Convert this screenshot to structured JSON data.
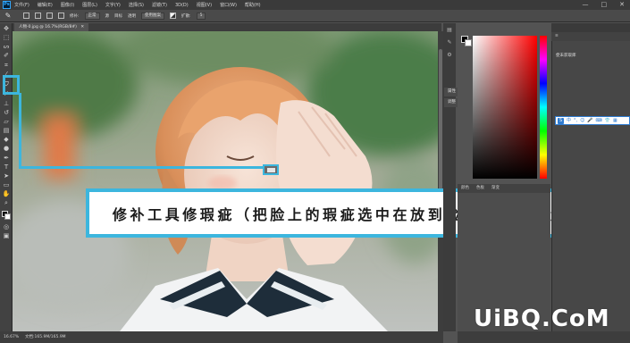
{
  "app": {
    "logo": "Ps",
    "window_controls": [
      "—",
      "□",
      "✕"
    ]
  },
  "menu": [
    "文件(F)",
    "编辑(E)",
    "图像(I)",
    "图层(L)",
    "文字(Y)",
    "选择(S)",
    "滤镜(T)",
    "3D(D)",
    "视图(V)",
    "窗口(W)",
    "帮助(H)"
  ],
  "options": {
    "patch_label": "修补:",
    "patch_mode": "正常",
    "source": "源",
    "target": "目标",
    "transparent": "透明",
    "use_pattern": "使用图案",
    "diffusion_label": "扩散:",
    "diffusion_value": "5"
  },
  "document": {
    "tab_title": "人物-0.jpg @ 16.7%(RGB/8#)",
    "close": "✕"
  },
  "status": {
    "zoom": "16.67%",
    "doc_size": "文档:165.9M/165.9M"
  },
  "right_mini_panels": {
    "properties": "属性",
    "adjustments": "调整"
  },
  "color_tabs": [
    "颜色",
    "色板",
    "渐变"
  ],
  "far_dock": {
    "libraries": "使未获取库",
    "ime_logo": "S"
  },
  "caption": "修补工具修瑕疵（把脸上的瑕疵选中在放到脸上干净的位置）",
  "watermark": "UiBQ.CoM",
  "icons": {
    "tools": [
      "move-icon",
      "marquee-icon",
      "lasso-icon",
      "quick-select-icon",
      "crop-icon",
      "eyedropper-icon",
      "patch-tool-icon",
      "brush-icon",
      "stamp-icon",
      "history-brush-icon",
      "eraser-icon",
      "gradient-icon",
      "blur-icon",
      "dodge-icon",
      "pen-icon",
      "type-icon",
      "path-select-icon",
      "shape-icon",
      "hand-icon",
      "zoom-icon"
    ]
  }
}
